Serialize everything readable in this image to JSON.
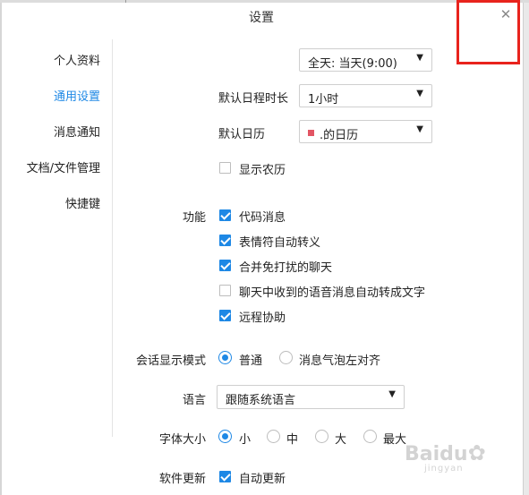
{
  "window": {
    "title": "设置"
  },
  "nav": [
    {
      "label": "个人资料",
      "active": false
    },
    {
      "label": "通用设置",
      "active": true
    },
    {
      "label": "消息通知",
      "active": false
    },
    {
      "label": "文档/文件管理",
      "active": false
    },
    {
      "label": "快捷键",
      "active": false
    }
  ],
  "schedule": {
    "allday_value": "全天: 当天(9:00)",
    "duration_label": "默认日程时长",
    "duration_value": "1小时",
    "calendar_label": "默认日历",
    "calendar_value": ".的日历",
    "calendar_color": "#e25564",
    "lunar_label": "显示农历",
    "lunar_checked": false
  },
  "features": {
    "label": "功能",
    "items": [
      {
        "label": "代码消息",
        "checked": true
      },
      {
        "label": "表情符自动转义",
        "checked": true
      },
      {
        "label": "合并免打扰的聊天",
        "checked": true
      },
      {
        "label": "聊天中收到的语音消息自动转成文字",
        "checked": false
      },
      {
        "label": "远程协助",
        "checked": true
      }
    ]
  },
  "display_mode": {
    "label": "会话显示模式",
    "options": [
      {
        "label": "普通",
        "selected": true
      },
      {
        "label": "消息气泡左对齐",
        "selected": false
      }
    ]
  },
  "language": {
    "label": "语言",
    "value": "跟随系统语言"
  },
  "font_size": {
    "label": "字体大小",
    "options": [
      {
        "label": "小",
        "selected": true
      },
      {
        "label": "中",
        "selected": false
      },
      {
        "label": "大",
        "selected": false
      },
      {
        "label": "最大",
        "selected": false
      }
    ]
  },
  "update": {
    "label": "软件更新",
    "option": "自动更新",
    "checked": true
  },
  "colors": {
    "accent": "#1e88e5",
    "highlight_box": "#e8231d"
  },
  "watermark": {
    "text": "Baidu",
    "sub": "jingyan"
  }
}
